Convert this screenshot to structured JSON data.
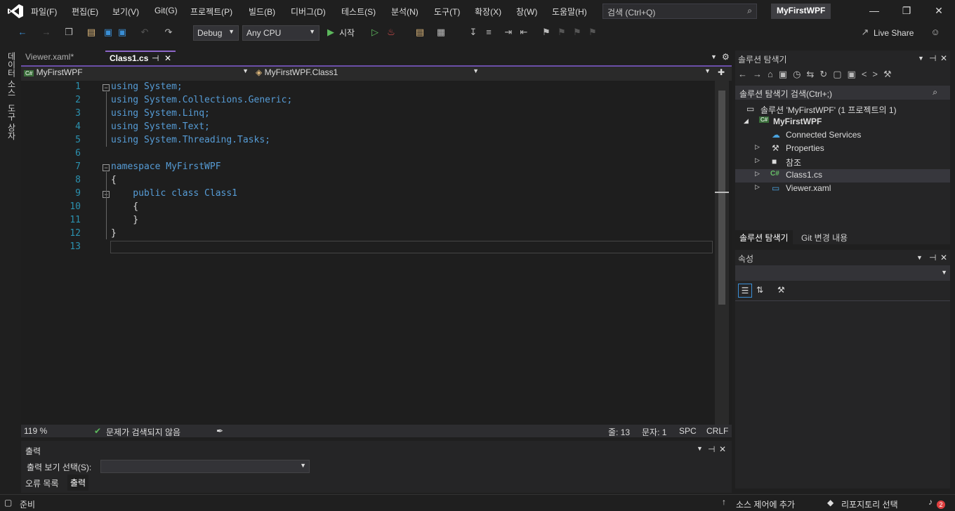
{
  "menu": [
    "파일(F)",
    "편집(E)",
    "보기(V)",
    "Git(G)",
    "프로젝트(P)",
    "빌드(B)",
    "디버그(D)",
    "테스트(S)",
    "분석(N)",
    "도구(T)",
    "확장(X)",
    "창(W)",
    "도움말(H)"
  ],
  "search": {
    "placeholder": "검색 (Ctrl+Q)"
  },
  "solution_name": "MyFirstWPF",
  "toolbar": {
    "config": "Debug",
    "platform": "Any CPU",
    "start_label": "시작",
    "live_share": "Live Share"
  },
  "left_tabs": [
    "데이터 소스",
    "도구 상자"
  ],
  "tabs": [
    {
      "label": "Viewer.xaml*"
    },
    {
      "label": "Class1.cs"
    }
  ],
  "nav": {
    "project": "MyFirstWPF",
    "class": "MyFirstWPF.Class1"
  },
  "code_lines": [
    {
      "n": "1",
      "text": "using System;"
    },
    {
      "n": "2",
      "text": "using System.Collections.Generic;"
    },
    {
      "n": "3",
      "text": "using System.Linq;"
    },
    {
      "n": "4",
      "text": "using System.Text;"
    },
    {
      "n": "5",
      "text": "using System.Threading.Tasks;"
    },
    {
      "n": "6",
      "text": ""
    },
    {
      "n": "7",
      "text": "namespace MyFirstWPF"
    },
    {
      "n": "8",
      "text": "{"
    },
    {
      "n": "9",
      "text": "    public class Class1"
    },
    {
      "n": "10",
      "text": "    {"
    },
    {
      "n": "11",
      "text": "    }"
    },
    {
      "n": "12",
      "text": "}"
    },
    {
      "n": "13",
      "text": ""
    }
  ],
  "editor_status": {
    "zoom": "119 %",
    "issues": "문제가 검색되지 않음",
    "line": "줄: 13",
    "col": "문자: 1",
    "spc": "SPC",
    "crlf": "CRLF"
  },
  "output": {
    "title": "출력",
    "select_label": "출력 보기 선택(S):",
    "tab_errors": "오류 목록",
    "tab_output": "출력"
  },
  "solution_explorer": {
    "title": "솔루션 탐색기",
    "search": "솔루션 탐색기 검색(Ctrl+;)",
    "root": "솔루션 'MyFirstWPF' (1 프로젝트의 1)",
    "project": "MyFirstWPF",
    "items": [
      "Connected Services",
      "Properties",
      "참조",
      "Class1.cs",
      "Viewer.xaml"
    ],
    "tab_solution": "솔루션 탐색기",
    "tab_git": "Git 변경 내용"
  },
  "properties": {
    "title": "속성"
  },
  "status": {
    "ready": "준비",
    "add_source": "소스 제어에 추가",
    "repo": "리포지토리 선택",
    "notif": "2"
  }
}
